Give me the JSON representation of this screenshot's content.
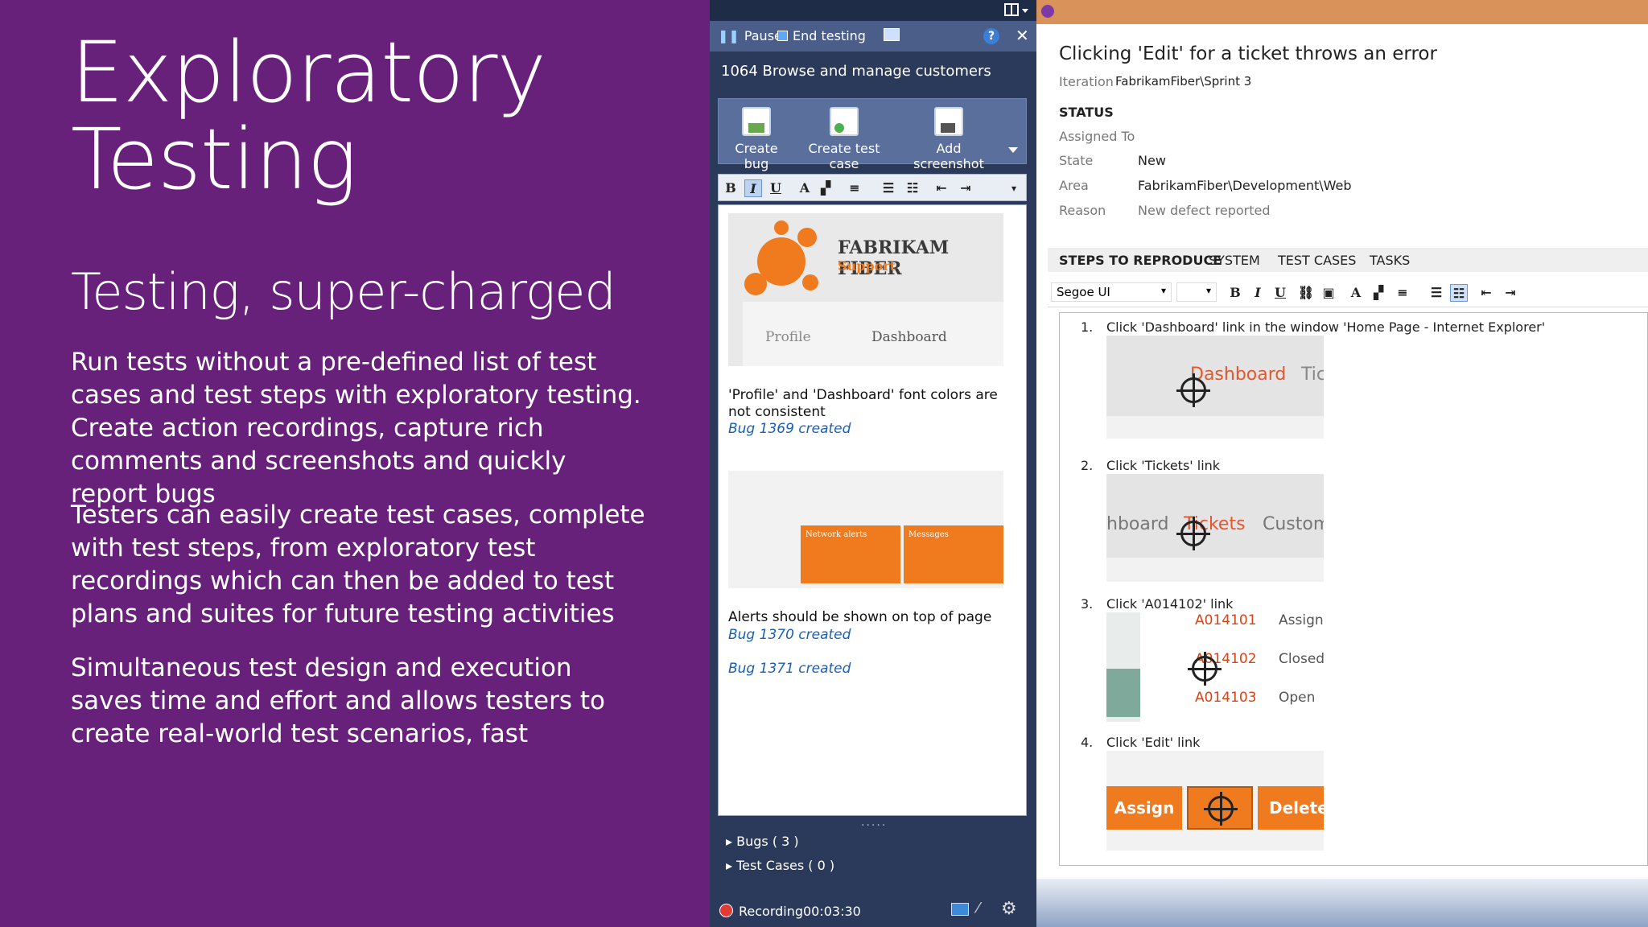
{
  "slide": {
    "title_line1": "Exploratory",
    "title_line2": "Testing",
    "subtitle": "Testing, super-charged",
    "paragraphs": [
      "Run tests without a pre-defined list of test cases and test steps with exploratory testing. Create action recordings, capture rich comments and screenshots and quickly report bugs",
      "Testers can easily create test cases, complete with test steps, from exploratory test recordings which can then be added to test plans and suites for future testing activities",
      "Simultaneous test design and execution saves time and effort and allows testers to create real-world test scenarios, fast"
    ]
  },
  "runner": {
    "pause_label": "Pause",
    "end_label": "End testing",
    "help_icon": "help-icon",
    "session_title": "1064 Browse and manage customers",
    "actions": [
      "Create bug",
      "Create test case",
      "Add screenshot"
    ],
    "shot1": {
      "brand": "FABRIKAM FIBER",
      "brand_sub": "Support",
      "nav1": "Profile",
      "nav2": "Dashboard"
    },
    "shot2": {
      "tile1": "Network alerts",
      "tile2": "Messages"
    },
    "note1": "'Profile' and 'Dashboard' font colors are not consistent",
    "bug1": "Bug 1369 created",
    "note2": "Alerts should be shown on top of page",
    "bug2": "Bug 1370 created",
    "bug3": "Bug 1371 created",
    "tree_bugs": "Bugs ( 3 )",
    "tree_tests": "Test Cases ( 0 )",
    "recording_label": "Recording",
    "recording_time": "00:03:30"
  },
  "workitem": {
    "title": "Clicking 'Edit' for a ticket throws an error",
    "iteration_label": "Iteration",
    "iteration_value": "FabrikamFiber\\Sprint 3",
    "status_header": "STATUS",
    "assigned_label": "Assigned To",
    "state_label": "State",
    "state_value": "New",
    "area_label": "Area",
    "area_value": "FabrikamFiber\\Development\\Web",
    "reason_label": "Reason",
    "reason_value": "New defect reported",
    "tabs": [
      "STEPS TO REPRODUCE",
      "SYSTEM",
      "TEST CASES",
      "TASKS"
    ],
    "font_name": "Segoe UI",
    "steps": [
      {
        "num": "1.",
        "text": "Click 'Dashboard' link in the window 'Home Page - Internet Explorer'",
        "img_a": "Dashboard",
        "img_b": "Tic"
      },
      {
        "num": "2.",
        "text": "Click 'Tickets' link",
        "img_a": "hboard",
        "img_b": "Tickets",
        "img_c": "Custom"
      },
      {
        "num": "3.",
        "text": "Click 'A014102' link",
        "rows": [
          [
            "A014101",
            "Assign"
          ],
          [
            "A014102",
            "Closed"
          ],
          [
            "A014103",
            "Open"
          ]
        ]
      },
      {
        "num": "4.",
        "text": "Click 'Edit' link",
        "btn_a": "Assign",
        "btn_c": "Delete"
      }
    ]
  },
  "colors": {
    "slide_bg": "#68217a",
    "runner_bg": "#2b3a5a",
    "link": "#1a5fb4",
    "accent_orange": "#f07a1e"
  }
}
